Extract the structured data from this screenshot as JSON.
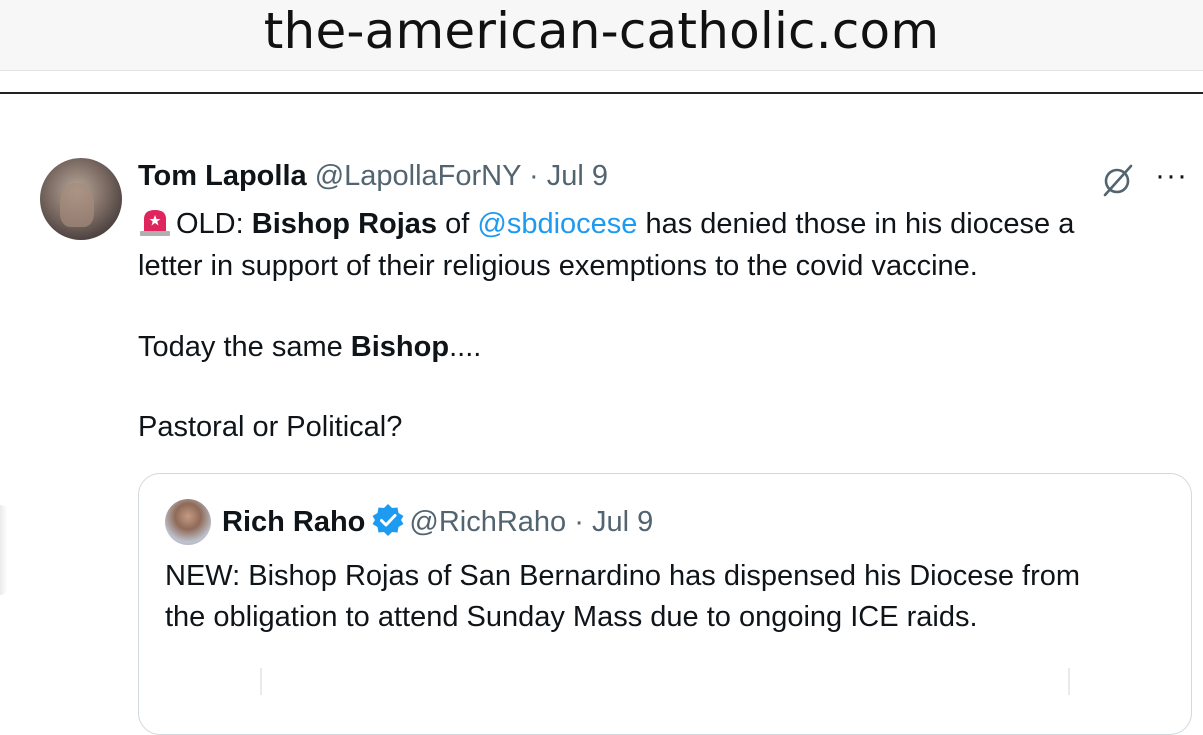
{
  "browser": {
    "domain": "the-american-catholic.com"
  },
  "tweet": {
    "author_name": "Tom Lapolla",
    "author_handle": "@LapollaForNY",
    "separator": " · ",
    "date": "Jul 9",
    "more_label": "···",
    "line1": {
      "prefix": "OLD: ",
      "bold_name": "Bishop Rojas",
      "of_text": " of ",
      "mention": "@sbdiocese",
      "rest": " has denied those in his diocese a"
    },
    "line2": "letter in support of their religious exemptions to the covid vaccine.",
    "line3": {
      "text": "Today the same ",
      "bold": "Bishop",
      "suffix": "...."
    },
    "line4": "Pastoral or Political?"
  },
  "quoted_tweet": {
    "author_name": "Rich Raho",
    "author_handle": "@RichRaho",
    "separator": " · ",
    "date": "Jul 9",
    "line1": "NEW: Bishop Rojas of San Bernardino has dispensed his Diocese from",
    "line2": "the obligation to attend Sunday Mass due to ongoing ICE raids."
  },
  "colors": {
    "link": "#1d9bf0",
    "muted": "#536471",
    "verified": "#1d9bf0",
    "siren": "#e0245e"
  },
  "icons": [
    "grok-icon",
    "more-icon",
    "siren-icon",
    "verified-badge-icon"
  ]
}
